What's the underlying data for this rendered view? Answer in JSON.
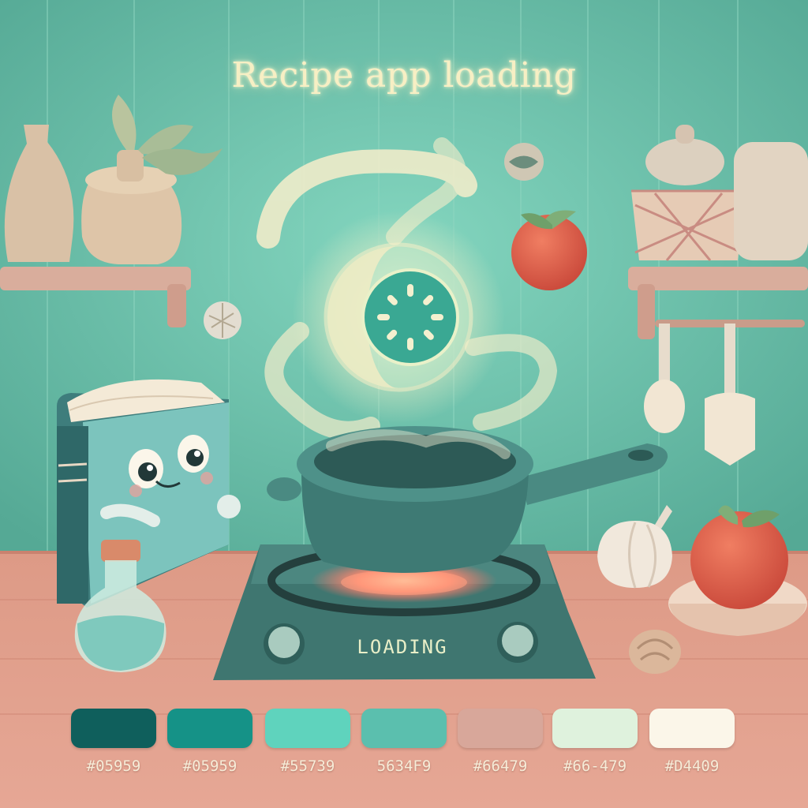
{
  "title": "Recipe app loading",
  "stove": {
    "label": "LOADING"
  },
  "palette": [
    {
      "color": "#0f5f5c",
      "label": "#05959"
    },
    {
      "color": "#159287",
      "label": "#05959"
    },
    {
      "color": "#5fd3bd",
      "label": "#55739"
    },
    {
      "color": "#5bbfae",
      "label": "5634F9"
    },
    {
      "color": "#d8a79a",
      "label": "#66479"
    },
    {
      "color": "#dff2dd",
      "label": "#66-479"
    },
    {
      "color": "#fbf6e9",
      "label": "#D4409"
    }
  ],
  "colors": {
    "wall": "#6cc4ac",
    "counter": "#e59e8c",
    "stove": "#3f7670",
    "pot": "#3e7a74",
    "spinner": "#3aa893",
    "glow": "#f6eecb"
  },
  "icons": [
    "spinner-icon"
  ]
}
